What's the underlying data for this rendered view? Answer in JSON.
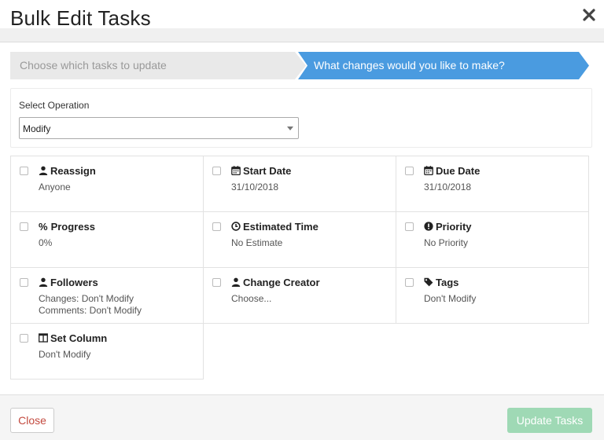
{
  "modal": {
    "title": "Bulk Edit Tasks",
    "close_icon": "close-icon"
  },
  "steps": [
    {
      "label": "Choose which tasks to update",
      "active": false
    },
    {
      "label": "What changes would you like to make?",
      "active": true
    }
  ],
  "operation": {
    "label": "Select Operation",
    "selected": "Modify"
  },
  "fields": [
    {
      "title": "Reassign",
      "icon": "user-icon",
      "values": [
        "Anyone"
      ]
    },
    {
      "title": "Start Date",
      "icon": "calendar-icon",
      "values": [
        "31/10/2018"
      ]
    },
    {
      "title": "Due Date",
      "icon": "calendar-icon",
      "values": [
        "31/10/2018"
      ]
    },
    {
      "title": "Progress",
      "icon": "percent-icon",
      "icon_text": "%",
      "values": [
        "0%"
      ]
    },
    {
      "title": "Estimated Time",
      "icon": "clock-icon",
      "values": [
        "No Estimate"
      ]
    },
    {
      "title": "Priority",
      "icon": "exclamation-circle-icon",
      "values": [
        "No Priority"
      ]
    },
    {
      "title": "Followers",
      "icon": "user-icon",
      "values": [
        "Changes: Don't Modify",
        "Comments: Don't Modify"
      ]
    },
    {
      "title": "Change Creator",
      "icon": "user-icon",
      "values": [
        "Choose..."
      ]
    },
    {
      "title": "Tags",
      "icon": "tag-icon",
      "values": [
        "Don't Modify"
      ]
    },
    {
      "title": "Set Column",
      "icon": "columns-icon",
      "values": [
        "Don't Modify"
      ]
    }
  ],
  "footer": {
    "close_label": "Close",
    "update_label": "Update Tasks"
  },
  "colors": {
    "step_active": "#4a9be0",
    "update_button": "#9fd9b5",
    "close_text": "#c34a3f"
  }
}
